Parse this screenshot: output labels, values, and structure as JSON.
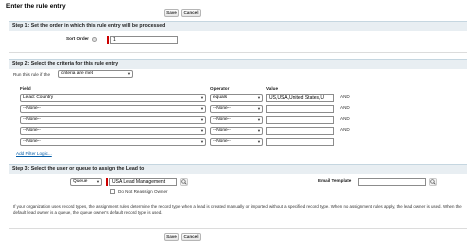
{
  "header": {
    "title": "Enter the rule entry",
    "save_label": "Save",
    "cancel_label": "Cancel"
  },
  "step1": {
    "title": "Step 1: Set the order in which this rule entry will be processed",
    "sort_order_label": "Sort Order",
    "sort_order_value": "1"
  },
  "step2": {
    "title": "Step 2: Select the criteria for this rule entry",
    "run_if_label": "Run this rule if the",
    "run_if_value": "criteria are met",
    "col_field": "Field",
    "col_operator": "Operator",
    "col_value": "Value",
    "rows": [
      {
        "field": "Lead: Country",
        "operator": "equals",
        "value": "US,USA,United States,U",
        "conj": "AND"
      },
      {
        "field": "--None--",
        "operator": "--None--",
        "value": "",
        "conj": "AND"
      },
      {
        "field": "--None--",
        "operator": "--None--",
        "value": "",
        "conj": "AND"
      },
      {
        "field": "--None--",
        "operator": "--None--",
        "value": "",
        "conj": "AND"
      },
      {
        "field": "--None--",
        "operator": "--None--",
        "value": "",
        "conj": ""
      }
    ],
    "add_filter_logic": "Add Filter Logic..."
  },
  "step3": {
    "title": "Step 3: Select the user or queue to assign the Lead to",
    "assignee_type": "Queue",
    "assignee_value": "USA Lead Management",
    "do_not_reassign_label": "Do Not Reassign Owner",
    "email_template_label": "Email Template",
    "email_template_value": ""
  },
  "footer_note": "If your organization uses record types, the assignment rules determine the record type when a lead is created manually or imported without a specified record type. When no assignment rules apply, the lead owner is used. When the default lead owner is a queue, the queue owner's default record type is used.",
  "bottom": {
    "save_label": "Save",
    "cancel_label": "Cancel"
  },
  "colors": {
    "section_bg": "#e8eef2",
    "required_bar": "#cc0000",
    "link": "#015ba7"
  },
  "icons": {
    "lookup": "lookup-icon",
    "help": "help-icon"
  }
}
